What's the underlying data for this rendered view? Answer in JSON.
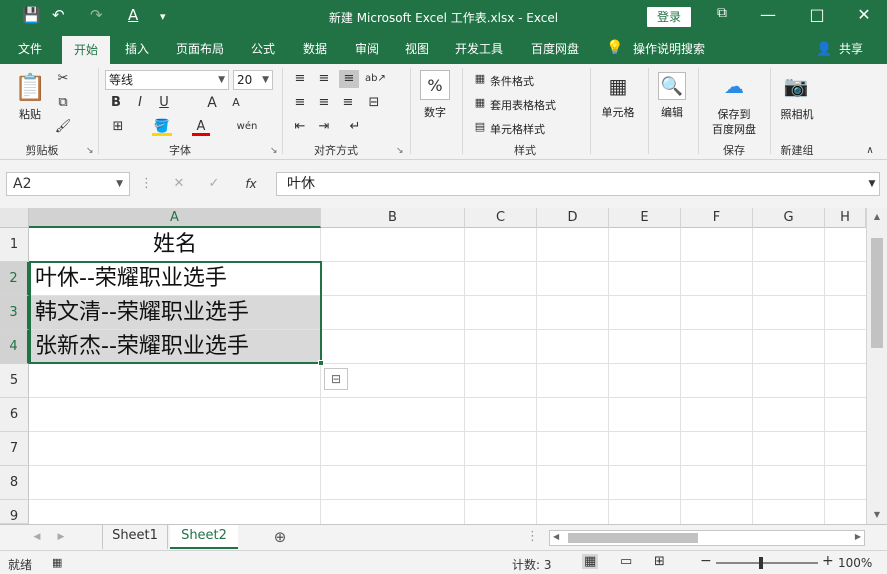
{
  "window": {
    "title": "新建 Microsoft Excel 工作表.xlsx  -  Excel",
    "login_label": "登录",
    "minimize": "—",
    "restore": "□",
    "close": "✕",
    "ribbon_display": "⧉"
  },
  "quick_access": {
    "save": "💾",
    "undo": "↶",
    "redo": "↷",
    "font_color": "A",
    "customize": "▾"
  },
  "tabs": [
    "文件",
    "开始",
    "插入",
    "页面布局",
    "公式",
    "数据",
    "审阅",
    "视图",
    "开发工具",
    "百度网盘"
  ],
  "active_tab": "开始",
  "tell_me": "操作说明搜索",
  "share_label": "共享",
  "ribbon": {
    "clipboard": {
      "label": "剪贴板",
      "paste": "粘贴"
    },
    "font": {
      "label": "字体",
      "name": "等线",
      "size": "20",
      "bold": "B",
      "italic": "I",
      "underline": "U",
      "grow": "A",
      "shrink": "A",
      "phonetic": "wén"
    },
    "alignment": {
      "label": "对齐方式"
    },
    "number": {
      "label": "数字",
      "format_label": "数字",
      "percent": "%"
    },
    "styles": {
      "label": "样式",
      "conditional": "条件格式",
      "table": "套用表格格式",
      "cell": "单元格样式"
    },
    "cells": {
      "label": "单元格"
    },
    "editing": {
      "label": "编辑"
    },
    "baidu": {
      "label": "保存",
      "line1": "保存到",
      "line2": "百度网盘"
    },
    "camera": {
      "label": "新建组",
      "text": "照相机"
    }
  },
  "formula_bar": {
    "name_box": "A2",
    "cancel": "✕",
    "enter": "✓",
    "fx": "fx",
    "content": "叶休"
  },
  "grid": {
    "columns": [
      "A",
      "B",
      "C",
      "D",
      "E",
      "F",
      "G",
      "H"
    ],
    "rows": [
      "1",
      "2",
      "3",
      "4",
      "5",
      "6",
      "7",
      "8",
      "9"
    ],
    "cells": {
      "A1": "姓名",
      "A2": "叶休--荣耀职业选手",
      "A3": "韩文清--荣耀职业选手",
      "A4": "张新杰--荣耀职业选手"
    }
  },
  "sheets": [
    "Sheet1",
    "Sheet2"
  ],
  "active_sheet": "Sheet2",
  "status": {
    "mode": "就绪",
    "count": "计数: 3",
    "zoom": "100%",
    "zoom_minus": "−",
    "zoom_plus": "+"
  },
  "colors": {
    "accent": "#217346",
    "selection_fill": "#d9d9d9"
  }
}
